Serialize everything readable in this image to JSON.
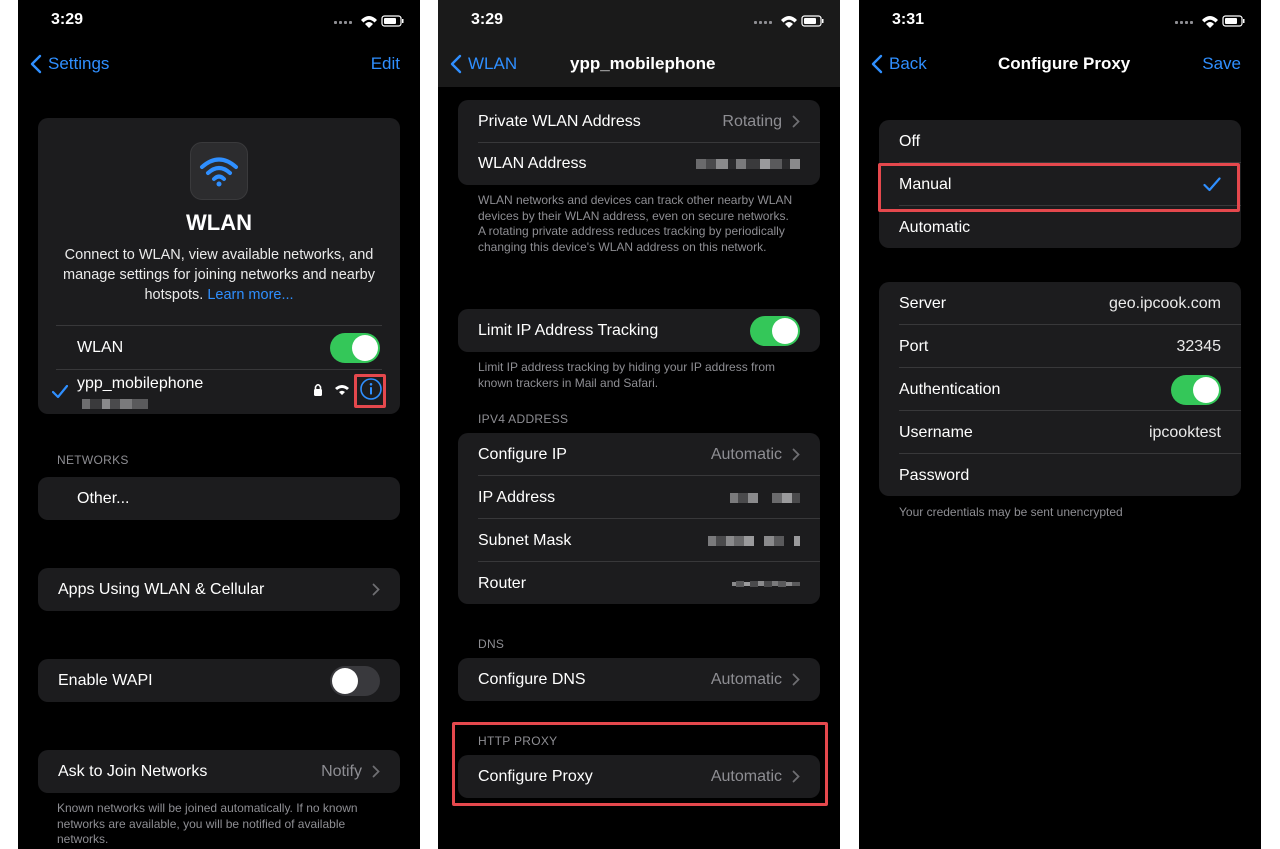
{
  "colors": {
    "accent": "#2f8fff",
    "toggle_on": "#34c759",
    "highlight": "#e5484d",
    "card": "#1c1c1e"
  },
  "screen1": {
    "time": "3:29",
    "back_label": "Settings",
    "edit_label": "Edit",
    "title": "WLAN",
    "description": "Connect to WLAN, view available networks, and manage settings for joining networks and nearby hotspots.",
    "learn_more": "Learn more...",
    "wlan_toggle_label": "WLAN",
    "wlan_toggle_on": true,
    "connected_network": "ypp_mobilephone",
    "networks_header": "NETWORKS",
    "other_label": "Other...",
    "apps_using_label": "Apps Using WLAN & Cellular",
    "enable_wapi_label": "Enable WAPI",
    "enable_wapi_on": false,
    "ask_join_label": "Ask to Join Networks",
    "ask_join_value": "Notify",
    "ask_join_footer": "Known networks will be joined automatically. If no known networks are available, you will be notified of available networks."
  },
  "screen2": {
    "time": "3:29",
    "back_label": "WLAN",
    "title": "ypp_mobilephone",
    "private_address_label": "Private WLAN Address",
    "private_address_value": "Rotating",
    "wlan_address_label": "WLAN Address",
    "private_footer": "WLAN networks and devices can track other nearby WLAN devices by their WLAN address, even on secure networks.\nA rotating private address reduces tracking by periodically changing this device's WLAN address on this network.",
    "limit_ip_label": "Limit IP Address Tracking",
    "limit_ip_on": true,
    "limit_ip_footer": "Limit IP address tracking by hiding your IP address from known trackers in Mail and Safari.",
    "ipv4_header": "IPV4 ADDRESS",
    "configure_ip_label": "Configure IP",
    "configure_ip_value": "Automatic",
    "ip_address_label": "IP Address",
    "subnet_mask_label": "Subnet Mask",
    "router_label": "Router",
    "dns_header": "DNS",
    "configure_dns_label": "Configure DNS",
    "configure_dns_value": "Automatic",
    "http_proxy_header": "HTTP PROXY",
    "configure_proxy_label": "Configure Proxy",
    "configure_proxy_value": "Automatic"
  },
  "screen3": {
    "time": "3:31",
    "back_label": "Back",
    "title": "Configure Proxy",
    "save_label": "Save",
    "options": [
      "Off",
      "Manual",
      "Automatic"
    ],
    "selected_option": "Manual",
    "server_label": "Server",
    "server_value": "geo.ipcook.com",
    "port_label": "Port",
    "port_value": "32345",
    "auth_label": "Authentication",
    "auth_on": true,
    "username_label": "Username",
    "username_value": "ipcooktest",
    "password_label": "Password",
    "footer": "Your credentials may be sent unencrypted"
  }
}
